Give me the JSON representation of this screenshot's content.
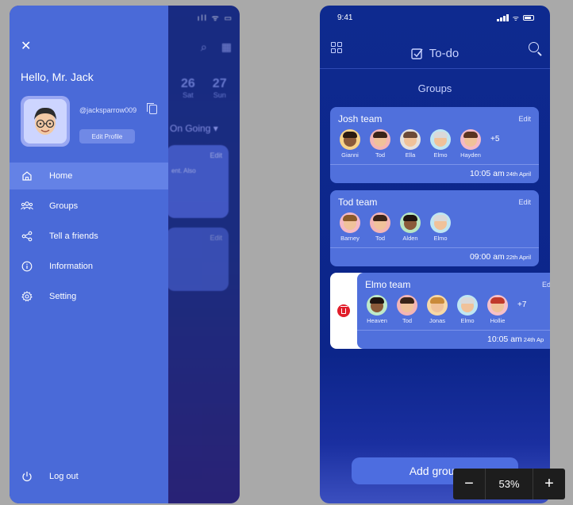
{
  "left_phone": {
    "background_app": {
      "dates": [
        {
          "num": "26",
          "day": "Sat"
        },
        {
          "num": "27",
          "day": "Sun"
        }
      ],
      "filter_label": "On Going",
      "card_edit_label": "Edit",
      "card_text_fragment": "ent. Also",
      "status_glyphs": "ıll ᯤ ▭"
    },
    "drawer": {
      "greeting": "Hello, Mr. Jack",
      "handle": "@jacksparrow009",
      "edit_profile_label": "Edit Profile",
      "menu": [
        {
          "label": "Home",
          "icon": "home-icon",
          "active": true
        },
        {
          "label": "Groups",
          "icon": "groups-icon",
          "active": false
        },
        {
          "label": "Tell a friends",
          "icon": "share-icon",
          "active": false
        },
        {
          "label": "Information",
          "icon": "info-icon",
          "active": false
        },
        {
          "label": "Setting",
          "icon": "gear-icon",
          "active": false
        }
      ],
      "logout_label": "Log out"
    }
  },
  "right_phone": {
    "status_time": "9:41",
    "app_title": "To-do",
    "section_title": "Groups",
    "groups": [
      {
        "name": "Josh team",
        "edit_label": "Edit",
        "members": [
          {
            "name": "Gianni",
            "bg": "#f6d38a"
          },
          {
            "name": "Tod",
            "bg": "#f3b5b5"
          },
          {
            "name": "Ella",
            "bg": "#e6e1dc"
          },
          {
            "name": "Elmo",
            "bg": "#bfe6f2"
          },
          {
            "name": "Hayden",
            "bg": "#f4b9c6"
          }
        ],
        "more": "+5",
        "time": "10:05 am",
        "date": "24th April"
      },
      {
        "name": "Tod team",
        "edit_label": "Edit",
        "members": [
          {
            "name": "Barney",
            "bg": "#f4b9c6"
          },
          {
            "name": "Tod",
            "bg": "#f3b5b5"
          },
          {
            "name": "Alden",
            "bg": "#b8e6c2"
          },
          {
            "name": "Elmo",
            "bg": "#bfe6f2"
          }
        ],
        "more": "",
        "time": "09:00 am",
        "date": "22th April"
      },
      {
        "name": "Elmo team",
        "edit_label": "Ed",
        "members": [
          {
            "name": "Heaven",
            "bg": "#bfe9c8"
          },
          {
            "name": "Tod",
            "bg": "#f3b5b5"
          },
          {
            "name": "Jonas",
            "bg": "#f6d8a6"
          },
          {
            "name": "Elmo",
            "bg": "#bfe6f2"
          },
          {
            "name": "Hollie",
            "bg": "#f6c0c8"
          }
        ],
        "more": "+7",
        "time": "10:05 am",
        "date": "24th Ap"
      }
    ],
    "add_button_label": "Add group",
    "colors": {
      "delete": "#e11d2a",
      "card": "#5070dc",
      "drawer": "#4a6ad8"
    }
  },
  "zoom_control": {
    "minus": "−",
    "level": "53%",
    "plus": "+"
  }
}
